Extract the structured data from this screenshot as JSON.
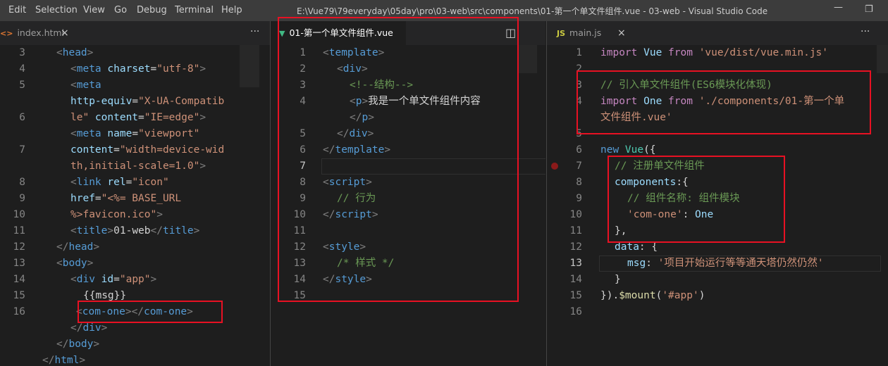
{
  "menu": [
    "Edit",
    "Selection",
    "View",
    "Go",
    "Debug",
    "Terminal",
    "Help"
  ],
  "window_title": "E:\\Vue79\\79everyday\\05day\\pro\\03-web\\src\\components\\01-第一个单文件组件.vue - 03-web - Visual Studio Code",
  "window_controls": {
    "minimize": "—",
    "restore": "❐"
  },
  "tabs": {
    "index": {
      "icon": "<>",
      "label": "index.html",
      "close": "×",
      "more": "···"
    },
    "vue": {
      "icon": "▼",
      "label": "01-第一个单文件组件.vue",
      "split": "◫"
    },
    "main": {
      "icon": "JS",
      "label": "main.js",
      "close": "×",
      "more": "···"
    }
  },
  "editor_index": {
    "line_numbers": [
      "3",
      "4",
      "5",
      "",
      "6",
      "",
      "7",
      "",
      "8",
      "9",
      "10",
      "11",
      "12",
      "13",
      "14",
      "15",
      "16"
    ],
    "lines": [
      [
        [
          "pun",
          "<"
        ],
        [
          "tag",
          "head"
        ],
        [
          "pun",
          ">"
        ]
      ],
      [
        [
          "pun",
          "<"
        ],
        [
          "tag",
          "meta "
        ],
        [
          "attr",
          "charset"
        ],
        [
          "txt",
          "="
        ],
        [
          "str",
          "\"utf-8\""
        ],
        [
          "pun",
          ">"
        ]
      ],
      [
        [
          "pun",
          "<"
        ],
        [
          "tag",
          "meta"
        ]
      ],
      [
        [
          "attr",
          "http-equiv"
        ],
        [
          "txt",
          "="
        ],
        [
          "str",
          "\"X-UA-Compatib"
        ]
      ],
      [
        [
          "str",
          "le\" "
        ],
        [
          "attr",
          "content"
        ],
        [
          "txt",
          "="
        ],
        [
          "str",
          "\"IE=edge\""
        ],
        [
          "pun",
          ">"
        ]
      ],
      [
        [
          "pun",
          "<"
        ],
        [
          "tag",
          "meta "
        ],
        [
          "attr",
          "name"
        ],
        [
          "txt",
          "="
        ],
        [
          "str",
          "\"viewport\""
        ]
      ],
      [
        [
          "attr",
          "content"
        ],
        [
          "txt",
          "="
        ],
        [
          "str",
          "\"width=device-wid"
        ]
      ],
      [
        [
          "str",
          "th,initial-scale=1.0\""
        ],
        [
          "pun",
          ">"
        ]
      ],
      [
        [
          "pun",
          "<"
        ],
        [
          "tag",
          "link "
        ],
        [
          "attr",
          "rel"
        ],
        [
          "txt",
          "="
        ],
        [
          "str",
          "\"icon\""
        ]
      ],
      [
        [
          "attr",
          "href"
        ],
        [
          "txt",
          "="
        ],
        [
          "str",
          "\"<%= BASE_URL"
        ]
      ],
      [
        [
          "str",
          "%>favicon.ico\""
        ],
        [
          "pun",
          ">"
        ]
      ],
      [
        [
          "pun",
          "<"
        ],
        [
          "tag",
          "title"
        ],
        [
          "pun",
          ">"
        ],
        [
          "txt",
          "01-web"
        ],
        [
          "pun",
          "</"
        ],
        [
          "tag",
          "title"
        ],
        [
          "pun",
          ">"
        ]
      ],
      [
        [
          "pun",
          "</"
        ],
        [
          "tag",
          "head"
        ],
        [
          "pun",
          ">"
        ]
      ],
      [
        [
          "pun",
          "<"
        ],
        [
          "tag",
          "body"
        ],
        [
          "pun",
          ">"
        ]
      ],
      [
        [
          "pun",
          "<"
        ],
        [
          "tag",
          "div "
        ],
        [
          "attr",
          "id"
        ],
        [
          "txt",
          "="
        ],
        [
          "str",
          "\"app\""
        ],
        [
          "pun",
          ">"
        ]
      ],
      [
        [
          "txt",
          "{{msg}}"
        ]
      ],
      [
        [
          "pun",
          "<"
        ],
        [
          "tag",
          "com-one"
        ],
        [
          "pun",
          "></"
        ],
        [
          "tag",
          "com-one"
        ],
        [
          "pun",
          ">"
        ]
      ],
      [
        [
          "pun",
          "</"
        ],
        [
          "tag",
          "div"
        ],
        [
          "pun",
          ">"
        ]
      ],
      [
        [
          "pun",
          "</"
        ],
        [
          "tag",
          "body"
        ],
        [
          "pun",
          ">"
        ]
      ],
      [
        [
          "pun",
          "</"
        ],
        [
          "tag",
          "html"
        ],
        [
          "pun",
          ">"
        ]
      ]
    ]
  },
  "editor_index_numbers": [
    "3",
    "4",
    "5",
    "",
    "6",
    "",
    "7",
    "",
    "8",
    "9",
    "10",
    "11",
    "12",
    "13",
    "14",
    "15",
    "16"
  ],
  "editor_vue": {
    "line_numbers": [
      "1",
      "2",
      "3",
      "4",
      "",
      "5",
      "6",
      "7",
      "8",
      "9",
      "10",
      "11",
      "12",
      "13",
      "14",
      "15"
    ],
    "lines": [
      [
        [
          "pun",
          "<"
        ],
        [
          "tag",
          "template"
        ],
        [
          "pun",
          ">"
        ]
      ],
      [
        [
          "pun",
          "<"
        ],
        [
          "tag",
          "div"
        ],
        [
          "pun",
          ">"
        ]
      ],
      [
        [
          "cmt",
          "<!--结构-->"
        ]
      ],
      [
        [
          "pun",
          "<"
        ],
        [
          "tag",
          "p"
        ],
        [
          "pun",
          ">"
        ],
        [
          "txt",
          "我是一个单文件组件内容"
        ]
      ],
      [
        [
          "pun",
          "</"
        ],
        [
          "tag",
          "p"
        ],
        [
          "pun",
          ">"
        ]
      ],
      [
        [
          "pun",
          "</"
        ],
        [
          "tag",
          "div"
        ],
        [
          "pun",
          ">"
        ]
      ],
      [
        [
          "pun",
          "</"
        ],
        [
          "tag",
          "template"
        ],
        [
          "pun",
          ">"
        ]
      ],
      [],
      [
        [
          "pun",
          "<"
        ],
        [
          "tag",
          "script"
        ],
        [
          "pun",
          ">"
        ]
      ],
      [
        [
          "cmt",
          "// 行为"
        ]
      ],
      [
        [
          "pun",
          "</"
        ],
        [
          "tag",
          "script"
        ],
        [
          "pun",
          ">"
        ]
      ],
      [],
      [
        [
          "pun",
          "<"
        ],
        [
          "tag",
          "style"
        ],
        [
          "pun",
          ">"
        ]
      ],
      [
        [
          "cmt",
          "/* 样式 */"
        ]
      ],
      [
        [
          "pun",
          "</"
        ],
        [
          "tag",
          "style"
        ],
        [
          "pun",
          ">"
        ]
      ],
      []
    ]
  },
  "editor_main": {
    "line_numbers": [
      "1",
      "2",
      "3",
      "4",
      "",
      "5",
      "6",
      "7",
      "8",
      "9",
      "10",
      "11",
      "12",
      "13",
      "14",
      "15",
      "16"
    ],
    "lines": [
      [
        [
          "imp",
          "import "
        ],
        [
          "var",
          "Vue "
        ],
        [
          "imp",
          "from "
        ],
        [
          "str",
          "'vue/dist/vue.min.js'"
        ]
      ],
      [],
      [
        [
          "cmt",
          "// 引入单文件组件(ES6模块化体现)"
        ]
      ],
      [
        [
          "imp",
          "import "
        ],
        [
          "var",
          "One "
        ],
        [
          "imp",
          "from "
        ],
        [
          "str",
          "'./components/01-第一个单"
        ]
      ],
      [
        [
          "str",
          "文件组件.vue'"
        ]
      ],
      [],
      [
        [
          "kw",
          "new "
        ],
        [
          "cls",
          "Vue"
        ],
        [
          "txt",
          "({"
        ]
      ],
      [
        [
          "cmt",
          "// 注册单文件组件"
        ]
      ],
      [
        [
          "var",
          "components"
        ],
        [
          "txt",
          ":{"
        ]
      ],
      [
        [
          "cmt",
          "// 组件名称: 组件模块"
        ]
      ],
      [
        [
          "str",
          "'com-one'"
        ],
        [
          "txt",
          ": "
        ],
        [
          "var",
          "One"
        ]
      ],
      [
        [
          "txt",
          "},"
        ]
      ],
      [
        [
          "var",
          "data"
        ],
        [
          "txt",
          ": {"
        ]
      ],
      [
        [
          "var",
          "msg"
        ],
        [
          "txt",
          ": "
        ],
        [
          "str",
          "'项目开始运行等等通天塔仍然仍然'"
        ]
      ],
      [
        [
          "txt",
          "}"
        ]
      ],
      [
        [
          "txt",
          "})."
        ],
        [
          "fn",
          "$mount"
        ],
        [
          "txt",
          "("
        ],
        [
          "str",
          "'#app'"
        ],
        [
          "txt",
          ")"
        ]
      ],
      []
    ]
  },
  "colors": {
    "red_box": "#e81123",
    "breakpoint": "#8b1a1a",
    "vue_green": "#41b883",
    "js_yellow": "#cbcb41",
    "html_orange": "#e37933"
  }
}
